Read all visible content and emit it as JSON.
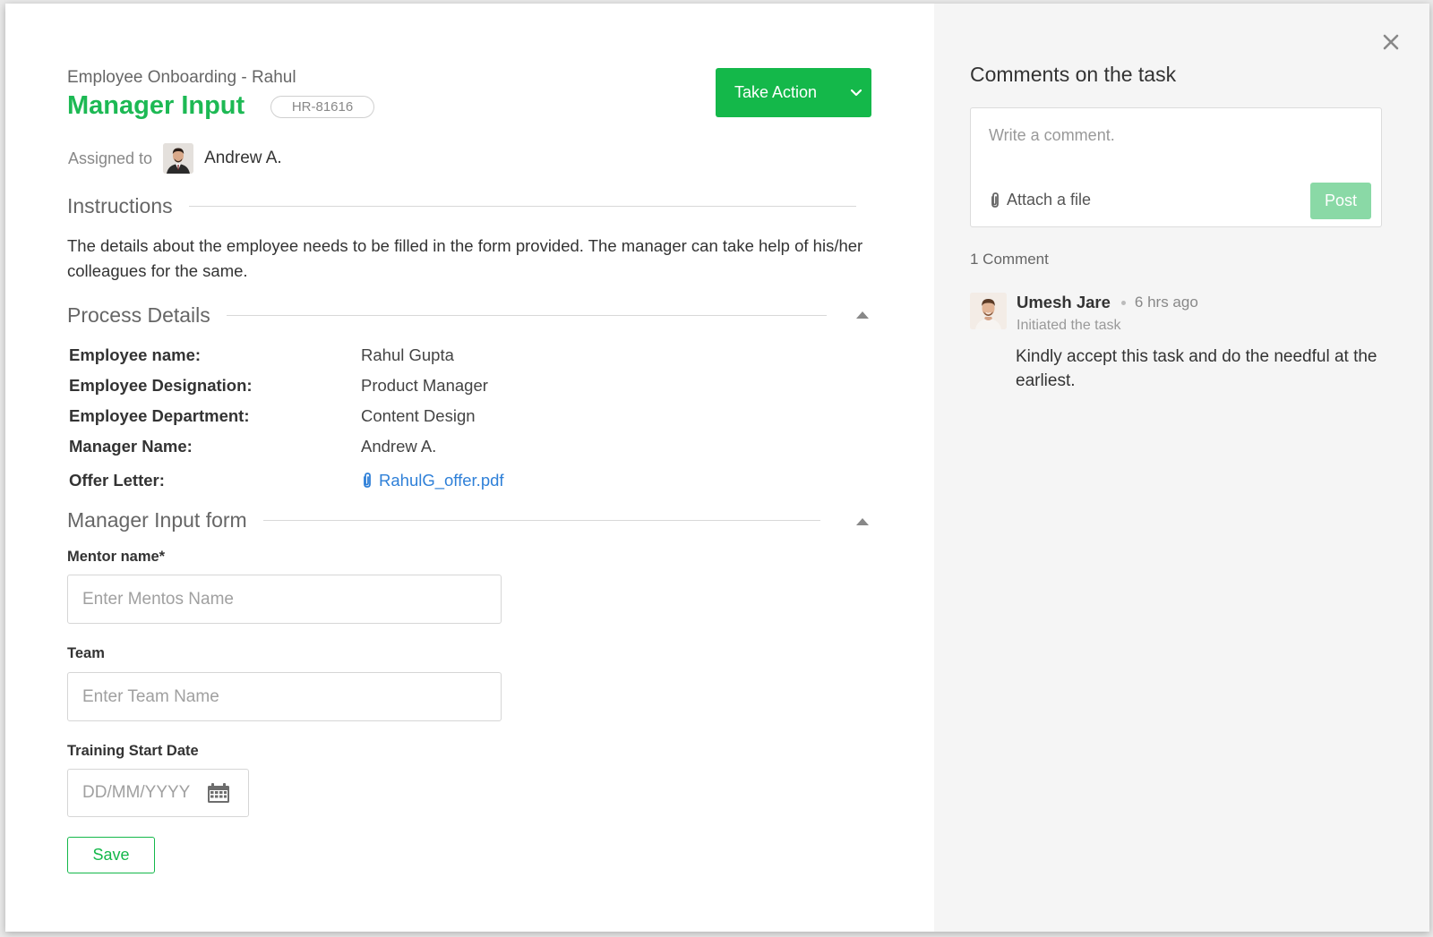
{
  "colors": {
    "accent": "#14b84a",
    "title_green": "#1db954",
    "link_blue": "#2f80d8",
    "post_disabled": "#8ad9a6",
    "panel_bg": "#f5f5f5"
  },
  "header": {
    "breadcrumb": "Employee Onboarding - Rahul",
    "title": "Manager Input",
    "task_id": "HR-81616",
    "take_action_label": "Take Action"
  },
  "assignment": {
    "label": "Assigned to",
    "assignee": "Andrew A."
  },
  "instructions": {
    "heading": "Instructions",
    "text": "The details about the employee needs to be filled in the form provided. The manager can take help of his/her colleagues for the same."
  },
  "process_details": {
    "heading": "Process Details",
    "rows": [
      {
        "label": "Employee name:",
        "value": "Rahul Gupta"
      },
      {
        "label": "Employee Designation:",
        "value": "Product Manager"
      },
      {
        "label": "Employee Department:",
        "value": "Content Design"
      },
      {
        "label": "Manager Name:",
        "value": "Andrew A."
      }
    ],
    "offer_letter_label": "Offer Letter:",
    "offer_letter_file": "RahulG_offer.pdf"
  },
  "form": {
    "heading": "Manager Input form",
    "mentor_label": "Mentor name*",
    "mentor_placeholder": "Enter Mentos Name",
    "team_label": "Team",
    "team_placeholder": "Enter Team Name",
    "date_label": "Training Start Date",
    "date_placeholder": "DD/MM/YYYY",
    "save_label": "Save"
  },
  "comments": {
    "title": "Comments on the task",
    "input_placeholder": "Write a comment.",
    "attach_label": "Attach a file",
    "post_label": "Post",
    "count_label": "1 Comment",
    "items": [
      {
        "author": "Umesh Jare",
        "time": "6 hrs ago",
        "subtitle": "Initiated the task",
        "body": "Kindly accept this task and do the needful at the earliest."
      }
    ]
  },
  "icons": {
    "close": "close-icon",
    "chevron": "chevron-down-icon",
    "paperclip": "paperclip-icon",
    "calendar": "calendar-icon",
    "collapse": "caret-up-icon"
  }
}
